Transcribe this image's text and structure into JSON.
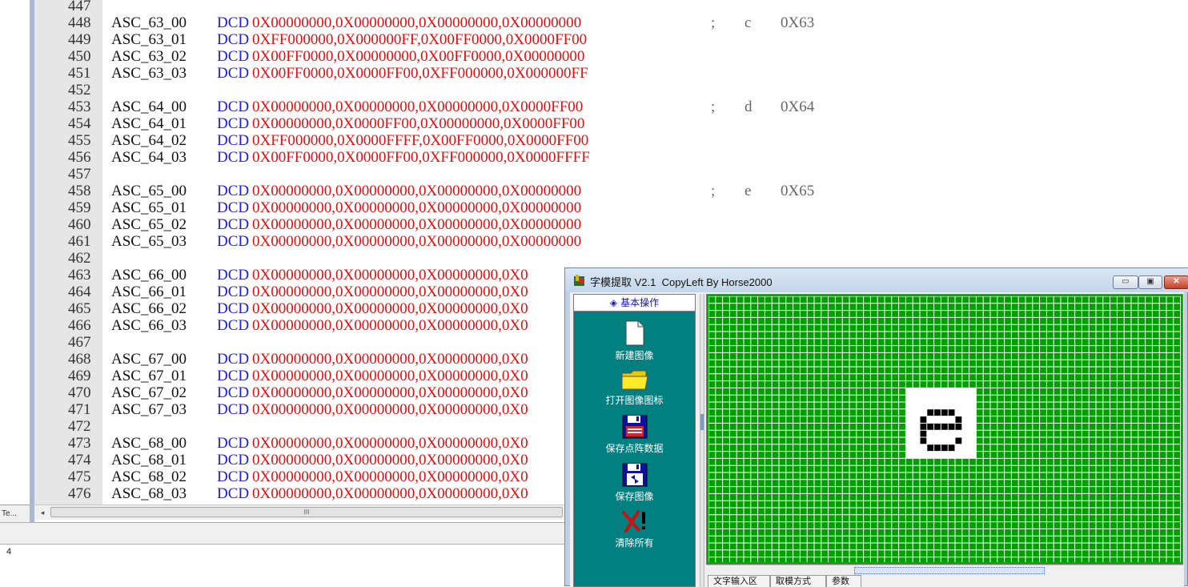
{
  "editor": {
    "left_tab_label": "Te...",
    "status_line_value": "4",
    "scroll_grip": "III",
    "scroll_left_arrow": "◂",
    "lines": [
      {
        "n": "447",
        "label": "",
        "kw": "",
        "vals": "",
        "semi": "",
        "ch": "",
        "hex": ""
      },
      {
        "n": "448",
        "label": "ASC_63_00",
        "kw": "DCD",
        "vals": "0X00000000,0X00000000,0X00000000,0X00000000",
        "semi": ";",
        "ch": "c",
        "hex": "0X63"
      },
      {
        "n": "449",
        "label": "ASC_63_01",
        "kw": "DCD",
        "vals": "0XFF000000,0X000000FF,0X00FF0000,0X0000FF00",
        "semi": "",
        "ch": "",
        "hex": ""
      },
      {
        "n": "450",
        "label": "ASC_63_02",
        "kw": "DCD",
        "vals": "0X00FF0000,0X00000000,0X00FF0000,0X00000000",
        "semi": "",
        "ch": "",
        "hex": ""
      },
      {
        "n": "451",
        "label": "ASC_63_03",
        "kw": "DCD",
        "vals": "0X00FF0000,0X0000FF00,0XFF000000,0X000000FF",
        "semi": "",
        "ch": "",
        "hex": ""
      },
      {
        "n": "452",
        "label": "",
        "kw": "",
        "vals": "",
        "semi": "",
        "ch": "",
        "hex": ""
      },
      {
        "n": "453",
        "label": "ASC_64_00",
        "kw": "DCD",
        "vals": "0X00000000,0X00000000,0X00000000,0X0000FF00",
        "semi": ";",
        "ch": "d",
        "hex": "0X64"
      },
      {
        "n": "454",
        "label": "ASC_64_01",
        "kw": "DCD",
        "vals": "0X00000000,0X0000FF00,0X00000000,0X0000FF00",
        "semi": "",
        "ch": "",
        "hex": ""
      },
      {
        "n": "455",
        "label": "ASC_64_02",
        "kw": "DCD",
        "vals": "0XFF000000,0X0000FFFF,0X00FF0000,0X0000FF00",
        "semi": "",
        "ch": "",
        "hex": ""
      },
      {
        "n": "456",
        "label": "ASC_64_03",
        "kw": "DCD",
        "vals": "0X00FF0000,0X0000FF00,0XFF000000,0X0000FFFF",
        "semi": "",
        "ch": "",
        "hex": ""
      },
      {
        "n": "457",
        "label": "",
        "kw": "",
        "vals": "",
        "semi": "",
        "ch": "",
        "hex": ""
      },
      {
        "n": "458",
        "label": "ASC_65_00",
        "kw": "DCD",
        "vals": "0X00000000,0X00000000,0X00000000,0X00000000",
        "semi": ";",
        "ch": "e",
        "hex": "0X65"
      },
      {
        "n": "459",
        "label": "ASC_65_01",
        "kw": "DCD",
        "vals": "0X00000000,0X00000000,0X00000000,0X00000000",
        "semi": "",
        "ch": "",
        "hex": ""
      },
      {
        "n": "460",
        "label": "ASC_65_02",
        "kw": "DCD",
        "vals": "0X00000000,0X00000000,0X00000000,0X00000000",
        "semi": "",
        "ch": "",
        "hex": ""
      },
      {
        "n": "461",
        "label": "ASC_65_03",
        "kw": "DCD",
        "vals": "0X00000000,0X00000000,0X00000000,0X00000000",
        "semi": "",
        "ch": "",
        "hex": ""
      },
      {
        "n": "462",
        "label": "",
        "kw": "",
        "vals": "",
        "semi": "",
        "ch": "",
        "hex": ""
      },
      {
        "n": "463",
        "label": "ASC_66_00",
        "kw": "DCD",
        "vals": "0X00000000,0X00000000,0X00000000,0X0",
        "semi": "",
        "ch": "",
        "hex": ""
      },
      {
        "n": "464",
        "label": "ASC_66_01",
        "kw": "DCD",
        "vals": "0X00000000,0X00000000,0X00000000,0X0",
        "semi": "",
        "ch": "",
        "hex": ""
      },
      {
        "n": "465",
        "label": "ASC_66_02",
        "kw": "DCD",
        "vals": "0X00000000,0X00000000,0X00000000,0X0",
        "semi": "",
        "ch": "",
        "hex": ""
      },
      {
        "n": "466",
        "label": "ASC_66_03",
        "kw": "DCD",
        "vals": "0X00000000,0X00000000,0X00000000,0X0",
        "semi": "",
        "ch": "",
        "hex": ""
      },
      {
        "n": "467",
        "label": "",
        "kw": "",
        "vals": "",
        "semi": "",
        "ch": "",
        "hex": ""
      },
      {
        "n": "468",
        "label": "ASC_67_00",
        "kw": "DCD",
        "vals": "0X00000000,0X00000000,0X00000000,0X0",
        "semi": "",
        "ch": "",
        "hex": ""
      },
      {
        "n": "469",
        "label": "ASC_67_01",
        "kw": "DCD",
        "vals": "0X00000000,0X00000000,0X00000000,0X0",
        "semi": "",
        "ch": "",
        "hex": ""
      },
      {
        "n": "470",
        "label": "ASC_67_02",
        "kw": "DCD",
        "vals": "0X00000000,0X00000000,0X00000000,0X0",
        "semi": "",
        "ch": "",
        "hex": ""
      },
      {
        "n": "471",
        "label": "ASC_67_03",
        "kw": "DCD",
        "vals": "0X00000000,0X00000000,0X00000000,0X0",
        "semi": "",
        "ch": "",
        "hex": ""
      },
      {
        "n": "472",
        "label": "",
        "kw": "",
        "vals": "",
        "semi": "",
        "ch": "",
        "hex": ""
      },
      {
        "n": "473",
        "label": "ASC_68_00",
        "kw": "DCD",
        "vals": "0X00000000,0X00000000,0X00000000,0X0",
        "semi": "",
        "ch": "",
        "hex": ""
      },
      {
        "n": "474",
        "label": "ASC_68_01",
        "kw": "DCD",
        "vals": "0X00000000,0X00000000,0X00000000,0X0",
        "semi": "",
        "ch": "",
        "hex": ""
      },
      {
        "n": "475",
        "label": "ASC_68_02",
        "kw": "DCD",
        "vals": "0X00000000,0X00000000,0X00000000,0X0",
        "semi": "",
        "ch": "",
        "hex": ""
      },
      {
        "n": "476",
        "label": "ASC_68_03",
        "kw": "DCD",
        "vals": "0X00000000,0X00000000,0X00000000,0X0",
        "semi": "",
        "ch": "",
        "hex": ""
      }
    ]
  },
  "dialog": {
    "title": "字模提取 V2.1  CopyLeft By Horse2000",
    "minimize_glyph": "▭",
    "maximize_glyph": "▣",
    "close_glyph": "✕",
    "sidebar_header_icon": "◈",
    "sidebar_header": "基本操作",
    "tools": [
      {
        "label": "新建图像",
        "icon": "new-file-icon"
      },
      {
        "label": "打开图像图标",
        "icon": "folder-icon"
      },
      {
        "label": "保存点阵数据",
        "icon": "floppy-data-icon"
      },
      {
        "label": "保存图像",
        "icon": "floppy-image-icon"
      },
      {
        "label": "清除所有",
        "icon": "clear-all-icon"
      }
    ],
    "tabs": [
      "文字输入区",
      "取模方式",
      "参数"
    ],
    "colors": {
      "grid_bg": "#00a000",
      "grid_line": "#ffffff",
      "pixel_on": "#000000",
      "glyph_bg": "#ffffff",
      "sidebar": "#008080"
    },
    "glyph": {
      "character": "e",
      "rows": [
        "0000000000",
        "0000000000",
        "0000000000",
        "0001111000",
        "0010000100",
        "0011111100",
        "0010000000",
        "0010000100",
        "0001111000",
        "0000000000"
      ]
    }
  }
}
